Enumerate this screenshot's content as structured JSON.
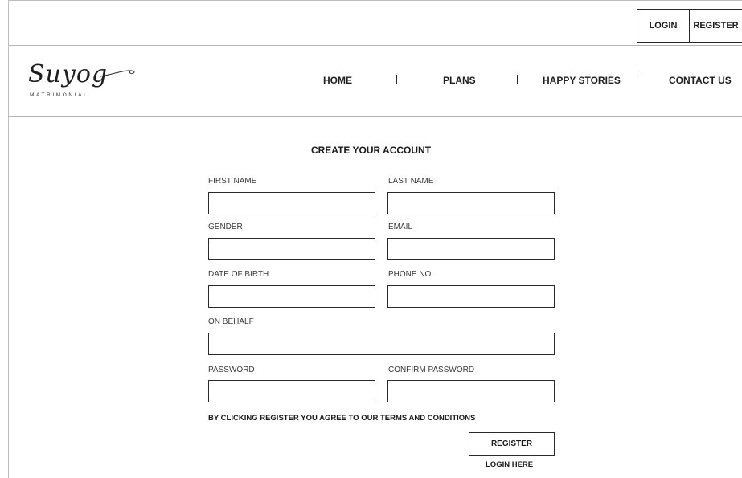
{
  "topbar": {
    "login_label": "LOGIN",
    "register_label": "REGISTER"
  },
  "logo": {
    "name": "Suyog",
    "tagline": "MATRIMONIAL"
  },
  "nav": {
    "home": "HOME",
    "plans": "PLANS",
    "happy_stories": "HAPPY STORIES",
    "contact_us": "CONTACT US"
  },
  "form": {
    "title": "CREATE YOUR ACCOUNT",
    "first_name_label": "FIRST NAME",
    "last_name_label": "LAST NAME",
    "gender_label": "GENDER",
    "email_label": "EMAIL",
    "dob_label": "DATE OF BIRTH",
    "phone_label": "PHONE NO.",
    "on_behalf_label": "ON BEHALF",
    "password_label": "PASSWORD",
    "confirm_password_label": "CONFIRM PASSWORD",
    "first_name_value": "",
    "last_name_value": "",
    "gender_value": "",
    "email_value": "",
    "dob_value": "",
    "phone_value": "",
    "on_behalf_value": "",
    "password_value": "",
    "confirm_password_value": "",
    "terms_text": "BY CLICKING REGISTER YOU AGREE TO OUR TERMS AND CONDITIONS",
    "submit_label": "REGISTER",
    "login_link": "LOGIN HERE"
  },
  "colors": {
    "border": "#2a2a2a",
    "divider": "#b5b5b5",
    "text": "#1a1a1a"
  }
}
